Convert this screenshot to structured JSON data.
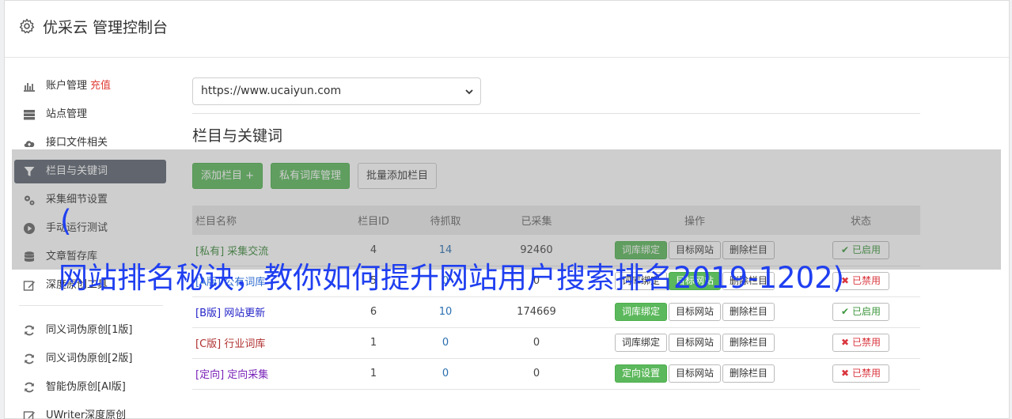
{
  "header": {
    "title": "优采云 管理控制台",
    "icon": "gear-icon"
  },
  "sidebar": {
    "items": [
      {
        "label": "账户管理",
        "tag": "充值",
        "icon": "bar-chart-icon",
        "active": false
      },
      {
        "label": "站点管理",
        "icon": "server-icon",
        "active": false
      },
      {
        "label": "接口文件相关",
        "icon": "cloud-upload-icon",
        "active": false
      },
      {
        "label": "栏目与关键词",
        "icon": "filter-icon",
        "active": true
      },
      {
        "label": "采集细节设置",
        "icon": "cogs-icon",
        "active": false
      },
      {
        "label": "手动运行测试",
        "icon": "play-circle-icon",
        "active": false
      },
      {
        "label": "文章暂存库",
        "icon": "database-icon",
        "active": false
      },
      {
        "label": "深度原创工具",
        "icon": "edit-icon",
        "active": false
      }
    ],
    "items2": [
      {
        "label": "同义词伪原创[1版]",
        "icon": "refresh-icon"
      },
      {
        "label": "同义词伪原创[2版]",
        "icon": "refresh-icon"
      },
      {
        "label": "智能伪原创[AI版]",
        "icon": "refresh-icon"
      },
      {
        "label": "UWriter深度原创",
        "icon": "edit-icon"
      }
    ]
  },
  "site_select": {
    "value": "https://www.ucaiyun.com"
  },
  "section": {
    "title": "栏目与关键词"
  },
  "toolbar": {
    "add": "添加栏目 +",
    "private": "私有词库管理",
    "batch": "批量添加栏目"
  },
  "table": {
    "headers": [
      "栏目名称",
      "栏目ID",
      "待抓取",
      "已采集",
      "操作",
      "状态"
    ],
    "rows": [
      {
        "tag": "[私有]",
        "name": "采集交流",
        "id": "4",
        "pending": "14",
        "collected": "92460",
        "op1": "词库绑定",
        "op2": "目标网站",
        "op3": "删除栏目",
        "status": "已启用",
        "color": "#3c8a3c",
        "op1green": true,
        "op2green": false,
        "on": true
      },
      {
        "tag": "[A版]",
        "name": "公有词库",
        "id": "5",
        "pending": "0",
        "collected": "0",
        "op1": "词库绑定",
        "op2": "目标网站",
        "op3": "删除栏目",
        "status": "已禁用",
        "color": "#2c6ad0",
        "op1green": false,
        "op2green": true,
        "on": false
      },
      {
        "tag": "[B版]",
        "name": "网站更新",
        "id": "6",
        "pending": "10",
        "collected": "174669",
        "op1": "词库绑定",
        "op2": "目标网站",
        "op3": "删除栏目",
        "status": "已启用",
        "color": "#2323c8",
        "op1green": true,
        "op2green": false,
        "on": true
      },
      {
        "tag": "[C版]",
        "name": "行业词库",
        "id": "1",
        "pending": "0",
        "collected": "0",
        "op1": "词库绑定",
        "op2": "目标网站",
        "op3": "删除栏目",
        "status": "已禁用",
        "color": "#b03030",
        "op1green": false,
        "op2green": false,
        "on": false
      },
      {
        "tag": "[定向]",
        "name": "定向采集",
        "id": "1",
        "pending": "0",
        "collected": "0",
        "op1": "定向设置",
        "op2": "目标网站",
        "op3": "删除栏目",
        "status": "已禁用",
        "color": "#7a23b8",
        "op1green": true,
        "op2green": false,
        "on": false
      }
    ]
  },
  "overlay": {
    "line1": "(",
    "line2": "网站排名秘诀，教你如何提升网站用户搜索排名2019-1202)"
  },
  "colors": {
    "active_bg": "#5d6470",
    "green": "#5cb85c",
    "red_tag": "#e0403a",
    "overlay_text": "#1f3ff0"
  }
}
